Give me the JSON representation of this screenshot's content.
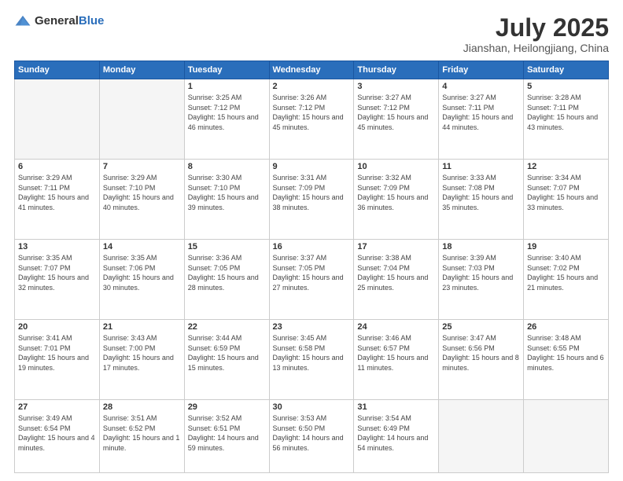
{
  "header": {
    "logo_general": "General",
    "logo_blue": "Blue",
    "month_year": "July 2025",
    "location": "Jianshan, Heilongjiang, China"
  },
  "weekdays": [
    "Sunday",
    "Monday",
    "Tuesday",
    "Wednesday",
    "Thursday",
    "Friday",
    "Saturday"
  ],
  "weeks": [
    [
      {
        "day": null
      },
      {
        "day": null
      },
      {
        "day": "1",
        "sunrise": "Sunrise: 3:25 AM",
        "sunset": "Sunset: 7:12 PM",
        "daylight": "Daylight: 15 hours and 46 minutes."
      },
      {
        "day": "2",
        "sunrise": "Sunrise: 3:26 AM",
        "sunset": "Sunset: 7:12 PM",
        "daylight": "Daylight: 15 hours and 45 minutes."
      },
      {
        "day": "3",
        "sunrise": "Sunrise: 3:27 AM",
        "sunset": "Sunset: 7:12 PM",
        "daylight": "Daylight: 15 hours and 45 minutes."
      },
      {
        "day": "4",
        "sunrise": "Sunrise: 3:27 AM",
        "sunset": "Sunset: 7:11 PM",
        "daylight": "Daylight: 15 hours and 44 minutes."
      },
      {
        "day": "5",
        "sunrise": "Sunrise: 3:28 AM",
        "sunset": "Sunset: 7:11 PM",
        "daylight": "Daylight: 15 hours and 43 minutes."
      }
    ],
    [
      {
        "day": "6",
        "sunrise": "Sunrise: 3:29 AM",
        "sunset": "Sunset: 7:11 PM",
        "daylight": "Daylight: 15 hours and 41 minutes."
      },
      {
        "day": "7",
        "sunrise": "Sunrise: 3:29 AM",
        "sunset": "Sunset: 7:10 PM",
        "daylight": "Daylight: 15 hours and 40 minutes."
      },
      {
        "day": "8",
        "sunrise": "Sunrise: 3:30 AM",
        "sunset": "Sunset: 7:10 PM",
        "daylight": "Daylight: 15 hours and 39 minutes."
      },
      {
        "day": "9",
        "sunrise": "Sunrise: 3:31 AM",
        "sunset": "Sunset: 7:09 PM",
        "daylight": "Daylight: 15 hours and 38 minutes."
      },
      {
        "day": "10",
        "sunrise": "Sunrise: 3:32 AM",
        "sunset": "Sunset: 7:09 PM",
        "daylight": "Daylight: 15 hours and 36 minutes."
      },
      {
        "day": "11",
        "sunrise": "Sunrise: 3:33 AM",
        "sunset": "Sunset: 7:08 PM",
        "daylight": "Daylight: 15 hours and 35 minutes."
      },
      {
        "day": "12",
        "sunrise": "Sunrise: 3:34 AM",
        "sunset": "Sunset: 7:07 PM",
        "daylight": "Daylight: 15 hours and 33 minutes."
      }
    ],
    [
      {
        "day": "13",
        "sunrise": "Sunrise: 3:35 AM",
        "sunset": "Sunset: 7:07 PM",
        "daylight": "Daylight: 15 hours and 32 minutes."
      },
      {
        "day": "14",
        "sunrise": "Sunrise: 3:35 AM",
        "sunset": "Sunset: 7:06 PM",
        "daylight": "Daylight: 15 hours and 30 minutes."
      },
      {
        "day": "15",
        "sunrise": "Sunrise: 3:36 AM",
        "sunset": "Sunset: 7:05 PM",
        "daylight": "Daylight: 15 hours and 28 minutes."
      },
      {
        "day": "16",
        "sunrise": "Sunrise: 3:37 AM",
        "sunset": "Sunset: 7:05 PM",
        "daylight": "Daylight: 15 hours and 27 minutes."
      },
      {
        "day": "17",
        "sunrise": "Sunrise: 3:38 AM",
        "sunset": "Sunset: 7:04 PM",
        "daylight": "Daylight: 15 hours and 25 minutes."
      },
      {
        "day": "18",
        "sunrise": "Sunrise: 3:39 AM",
        "sunset": "Sunset: 7:03 PM",
        "daylight": "Daylight: 15 hours and 23 minutes."
      },
      {
        "day": "19",
        "sunrise": "Sunrise: 3:40 AM",
        "sunset": "Sunset: 7:02 PM",
        "daylight": "Daylight: 15 hours and 21 minutes."
      }
    ],
    [
      {
        "day": "20",
        "sunrise": "Sunrise: 3:41 AM",
        "sunset": "Sunset: 7:01 PM",
        "daylight": "Daylight: 15 hours and 19 minutes."
      },
      {
        "day": "21",
        "sunrise": "Sunrise: 3:43 AM",
        "sunset": "Sunset: 7:00 PM",
        "daylight": "Daylight: 15 hours and 17 minutes."
      },
      {
        "day": "22",
        "sunrise": "Sunrise: 3:44 AM",
        "sunset": "Sunset: 6:59 PM",
        "daylight": "Daylight: 15 hours and 15 minutes."
      },
      {
        "day": "23",
        "sunrise": "Sunrise: 3:45 AM",
        "sunset": "Sunset: 6:58 PM",
        "daylight": "Daylight: 15 hours and 13 minutes."
      },
      {
        "day": "24",
        "sunrise": "Sunrise: 3:46 AM",
        "sunset": "Sunset: 6:57 PM",
        "daylight": "Daylight: 15 hours and 11 minutes."
      },
      {
        "day": "25",
        "sunrise": "Sunrise: 3:47 AM",
        "sunset": "Sunset: 6:56 PM",
        "daylight": "Daylight: 15 hours and 8 minutes."
      },
      {
        "day": "26",
        "sunrise": "Sunrise: 3:48 AM",
        "sunset": "Sunset: 6:55 PM",
        "daylight": "Daylight: 15 hours and 6 minutes."
      }
    ],
    [
      {
        "day": "27",
        "sunrise": "Sunrise: 3:49 AM",
        "sunset": "Sunset: 6:54 PM",
        "daylight": "Daylight: 15 hours and 4 minutes."
      },
      {
        "day": "28",
        "sunrise": "Sunrise: 3:51 AM",
        "sunset": "Sunset: 6:52 PM",
        "daylight": "Daylight: 15 hours and 1 minute."
      },
      {
        "day": "29",
        "sunrise": "Sunrise: 3:52 AM",
        "sunset": "Sunset: 6:51 PM",
        "daylight": "Daylight: 14 hours and 59 minutes."
      },
      {
        "day": "30",
        "sunrise": "Sunrise: 3:53 AM",
        "sunset": "Sunset: 6:50 PM",
        "daylight": "Daylight: 14 hours and 56 minutes."
      },
      {
        "day": "31",
        "sunrise": "Sunrise: 3:54 AM",
        "sunset": "Sunset: 6:49 PM",
        "daylight": "Daylight: 14 hours and 54 minutes."
      },
      {
        "day": null
      },
      {
        "day": null
      }
    ]
  ]
}
